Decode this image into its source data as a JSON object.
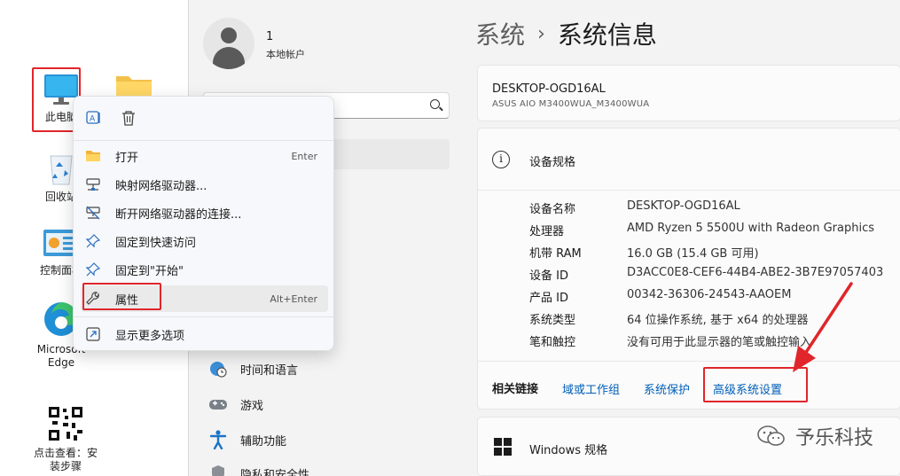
{
  "colors": {
    "accent": "#0067c0",
    "highlight_red": "#e0262b",
    "link": "#005fb8"
  },
  "desktop": {
    "icons": [
      {
        "label": "此电脑",
        "icon": "monitor-icon"
      },
      {
        "label": "",
        "icon": "folder-icon"
      },
      {
        "label": "回收站",
        "icon": "recycle-bin-icon"
      },
      {
        "label": "控制面板",
        "icon": "control-panel-icon"
      },
      {
        "label": "Microsoft Edge",
        "icon": "edge-icon"
      },
      {
        "label": "点击查看：安装步骤",
        "icon": "qr-code-icon"
      }
    ]
  },
  "context_menu": {
    "toolbar": [
      {
        "icon": "rename-icon"
      },
      {
        "icon": "delete-icon"
      }
    ],
    "items": [
      {
        "label": "打开",
        "shortcut": "Enter",
        "icon": "folder-open-icon"
      },
      {
        "label": "映射网络驱动器...",
        "shortcut": "",
        "icon": "map-drive-icon"
      },
      {
        "label": "断开网络驱动器的连接...",
        "shortcut": "",
        "icon": "disconnect-drive-icon"
      },
      {
        "label": "固定到快速访问",
        "shortcut": "",
        "icon": "pin-icon"
      },
      {
        "label": "固定到\"开始\"",
        "shortcut": "",
        "icon": "pin-icon"
      },
      {
        "label": "属性",
        "shortcut": "Alt+Enter",
        "icon": "wrench-icon"
      },
      {
        "label": "显示更多选项",
        "shortcut": "",
        "icon": "more-options-icon"
      }
    ]
  },
  "settings": {
    "user": {
      "name": "1",
      "account_type": "本地帐户"
    },
    "nav": [
      {
        "label": "时间和语言",
        "icon": "globe-clock-icon"
      },
      {
        "label": "游戏",
        "icon": "gamepad-icon"
      },
      {
        "label": "辅助功能",
        "icon": "accessibility-icon"
      },
      {
        "label": "隐私和安全性",
        "icon": "shield-icon"
      }
    ],
    "breadcrumb": {
      "parent": "系统",
      "separator": "›",
      "current": "系统信息"
    },
    "device": {
      "name": "DESKTOP-OGD16AL",
      "model": "ASUS AIO M3400WUA_M3400WUA"
    },
    "specs": {
      "title": "设备规格",
      "rows": [
        {
          "key": "设备名称",
          "value": "DESKTOP-OGD16AL"
        },
        {
          "key": "处理器",
          "value": "AMD Ryzen 5 5500U with Radeon Graphics"
        },
        {
          "key": "机带 RAM",
          "value": "16.0 GB (15.4 GB 可用)"
        },
        {
          "key": "设备 ID",
          "value": "D3ACC0E8-CEF6-44B4-ABE2-3B7E97057403"
        },
        {
          "key": "产品 ID",
          "value": "00342-36306-24543-AAOEM"
        },
        {
          "key": "系统类型",
          "value": "64 位操作系统, 基于 x64 的处理器"
        },
        {
          "key": "笔和触控",
          "value": "没有可用于此显示器的笔或触控输入"
        }
      ]
    },
    "related": {
      "label": "相关链接",
      "links": [
        "域或工作组",
        "系统保护",
        "高级系统设置"
      ]
    },
    "windows_spec": {
      "title": "Windows 规格"
    }
  },
  "watermark": {
    "text": "予乐科技",
    "icon": "wechat-icon"
  }
}
